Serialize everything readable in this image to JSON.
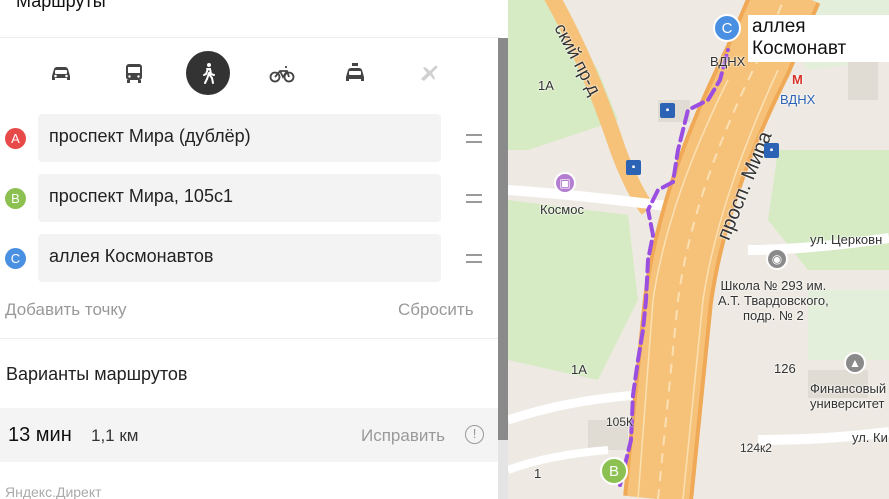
{
  "panel": {
    "title": "Маршруты",
    "modes": [
      {
        "name": "car",
        "icon": "car-icon",
        "active": false
      },
      {
        "name": "bus",
        "icon": "bus-icon",
        "active": false
      },
      {
        "name": "walk",
        "icon": "pedestrian-icon",
        "active": true
      },
      {
        "name": "bike",
        "icon": "bicycle-icon",
        "active": false
      },
      {
        "name": "taxi",
        "icon": "taxi-icon",
        "active": false
      },
      {
        "name": "plane",
        "icon": "plane-icon",
        "active": false
      }
    ],
    "waypoints": [
      {
        "letter": "A",
        "value": "проспект Мира (дублёр)",
        "color": "#e84a4a"
      },
      {
        "letter": "B",
        "value": "проспект Мира, 105с1",
        "color": "#8cc152"
      },
      {
        "letter": "C",
        "value": "аллея Космонавтов",
        "color": "#4a90e2"
      }
    ],
    "add_point": "Добавить точку",
    "reset": "Сбросить",
    "variants_title": "Варианты маршрутов",
    "route": {
      "time": "13 мин",
      "distance": "1,1 км",
      "fix": "Исправить",
      "info": "!"
    },
    "ad_label": "Яндекс.Директ"
  },
  "map": {
    "destination": {
      "letter": "C",
      "label": "аллея Космонавт"
    },
    "start_pin": {
      "letter": "B"
    },
    "labels": {
      "road_left": "ский пр-д",
      "prospect": "просп. Мира",
      "church_street": "ул. Церковн",
      "vdnh_1": "ВДНХ",
      "vdnh_2": "ВДНХ",
      "metro": "М",
      "kosmos": "Космос",
      "house_1a_top": "1А",
      "house_1a_bottom": "1А",
      "school": "Школа № 293 им.\nА.Т. Твардовского,\nподр. № 2",
      "house_126": "126",
      "finance": "Финансовый\nуниверситет",
      "house_105k": "105К",
      "house_124k2": "124к2",
      "street_k": "ул. Ки",
      "house_1": "1"
    },
    "colors": {
      "route": "#9b4fe0",
      "road": "#f6c27a",
      "green": "#cfe7b8",
      "water": "#b5d0e9"
    }
  }
}
